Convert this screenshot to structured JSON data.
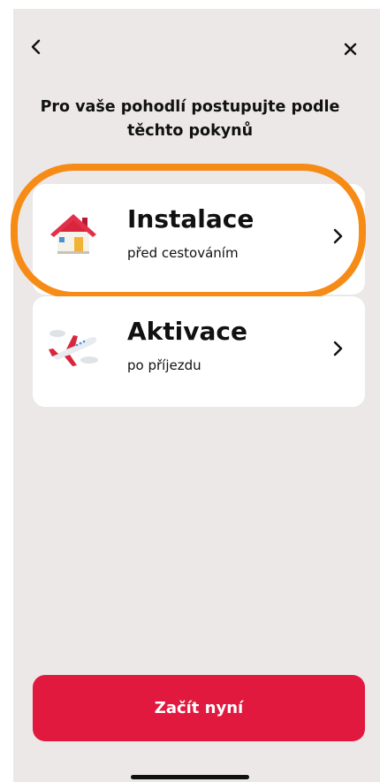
{
  "header": {
    "back_icon": "chevron-left-icon",
    "close_icon": "close-icon",
    "title": "Pro vaše pohodlí postupujte podle těchto pokynů"
  },
  "options": [
    {
      "title": "Instalace",
      "subtitle": "před cestováním",
      "icon": "house-icon",
      "highlighted": true
    },
    {
      "title": "Aktivace",
      "subtitle": "po příjezdu",
      "icon": "airplane-icon",
      "highlighted": false
    }
  ],
  "cta": {
    "label": "Začít nyní"
  },
  "colors": {
    "background": "#ece8e7",
    "card": "#ffffff",
    "accent": "#e2193e",
    "highlight": "#f68b16"
  }
}
